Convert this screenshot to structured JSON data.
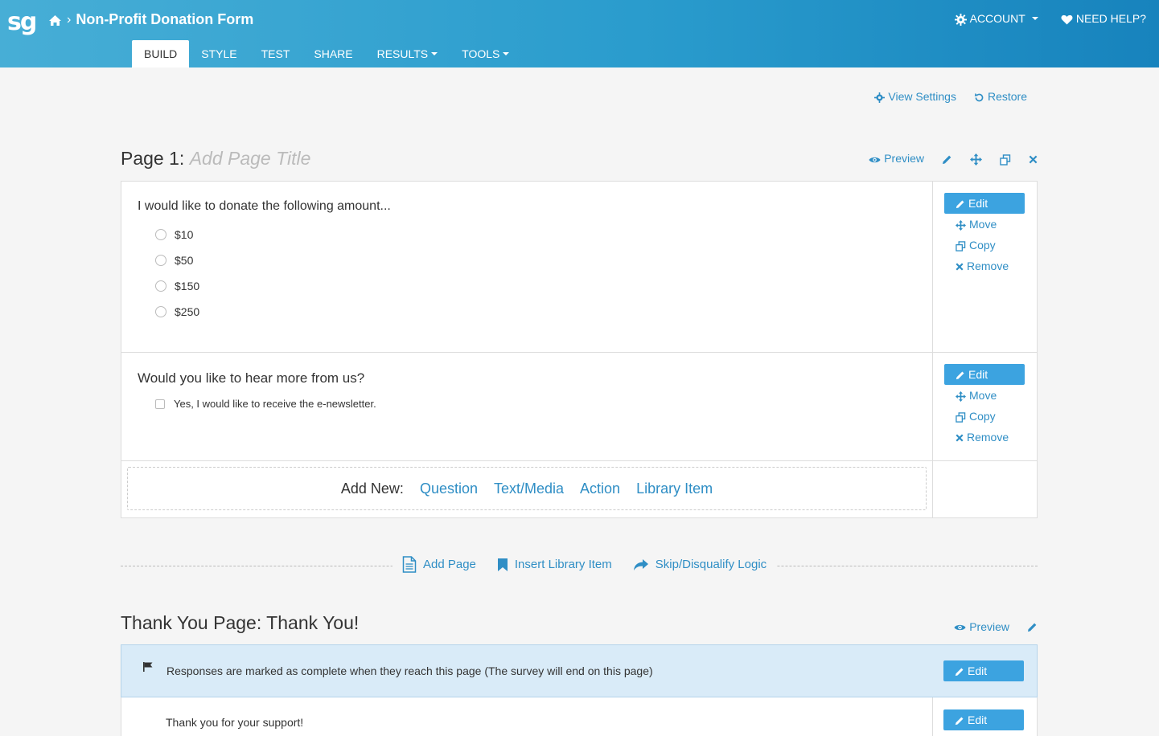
{
  "header": {
    "logo": "sg",
    "breadcrumb_title": "Non-Profit Donation Form",
    "account_label": "ACCOUNT",
    "help_label": "NEED HELP?",
    "tabs": [
      {
        "label": "BUILD",
        "active": true
      },
      {
        "label": "STYLE"
      },
      {
        "label": "TEST"
      },
      {
        "label": "SHARE"
      },
      {
        "label": "RESULTS",
        "dropdown": true
      },
      {
        "label": "TOOLS",
        "dropdown": true
      }
    ]
  },
  "toolbar": {
    "view_settings": "View Settings",
    "restore": "Restore"
  },
  "page1": {
    "label": "Page 1:",
    "title_placeholder": "Add Page Title",
    "preview": "Preview",
    "questions": [
      {
        "title": "I would like to donate the following amount...",
        "type": "radio",
        "options": [
          "$10",
          "$50",
          "$150",
          "$250"
        ]
      },
      {
        "title": "Would you like to hear more from us?",
        "type": "checkbox",
        "options": [
          "Yes, I would like to receive the e-newsletter."
        ]
      }
    ],
    "actions": {
      "edit": "Edit",
      "move": "Move",
      "copy": "Copy",
      "remove": "Remove"
    },
    "add_new": {
      "label": "Add New:",
      "items": [
        "Question",
        "Text/Media",
        "Action",
        "Library Item"
      ]
    }
  },
  "divider_actions": {
    "add_page": "Add Page",
    "insert_library": "Insert Library Item",
    "skip_logic": "Skip/Disqualify Logic"
  },
  "thank_you": {
    "title": "Thank You Page: Thank You!",
    "preview": "Preview",
    "complete_notice": "Responses are marked as complete when they reach this page (The survey will end on this page)",
    "message": "Thank you for your support!",
    "edit": "Edit"
  },
  "colors": {
    "header_start": "#47aed6",
    "header_end": "#1783bd",
    "link": "#2f8ec5",
    "edit_button": "#3ca3e0",
    "notice_bg": "#d9ebf8"
  }
}
